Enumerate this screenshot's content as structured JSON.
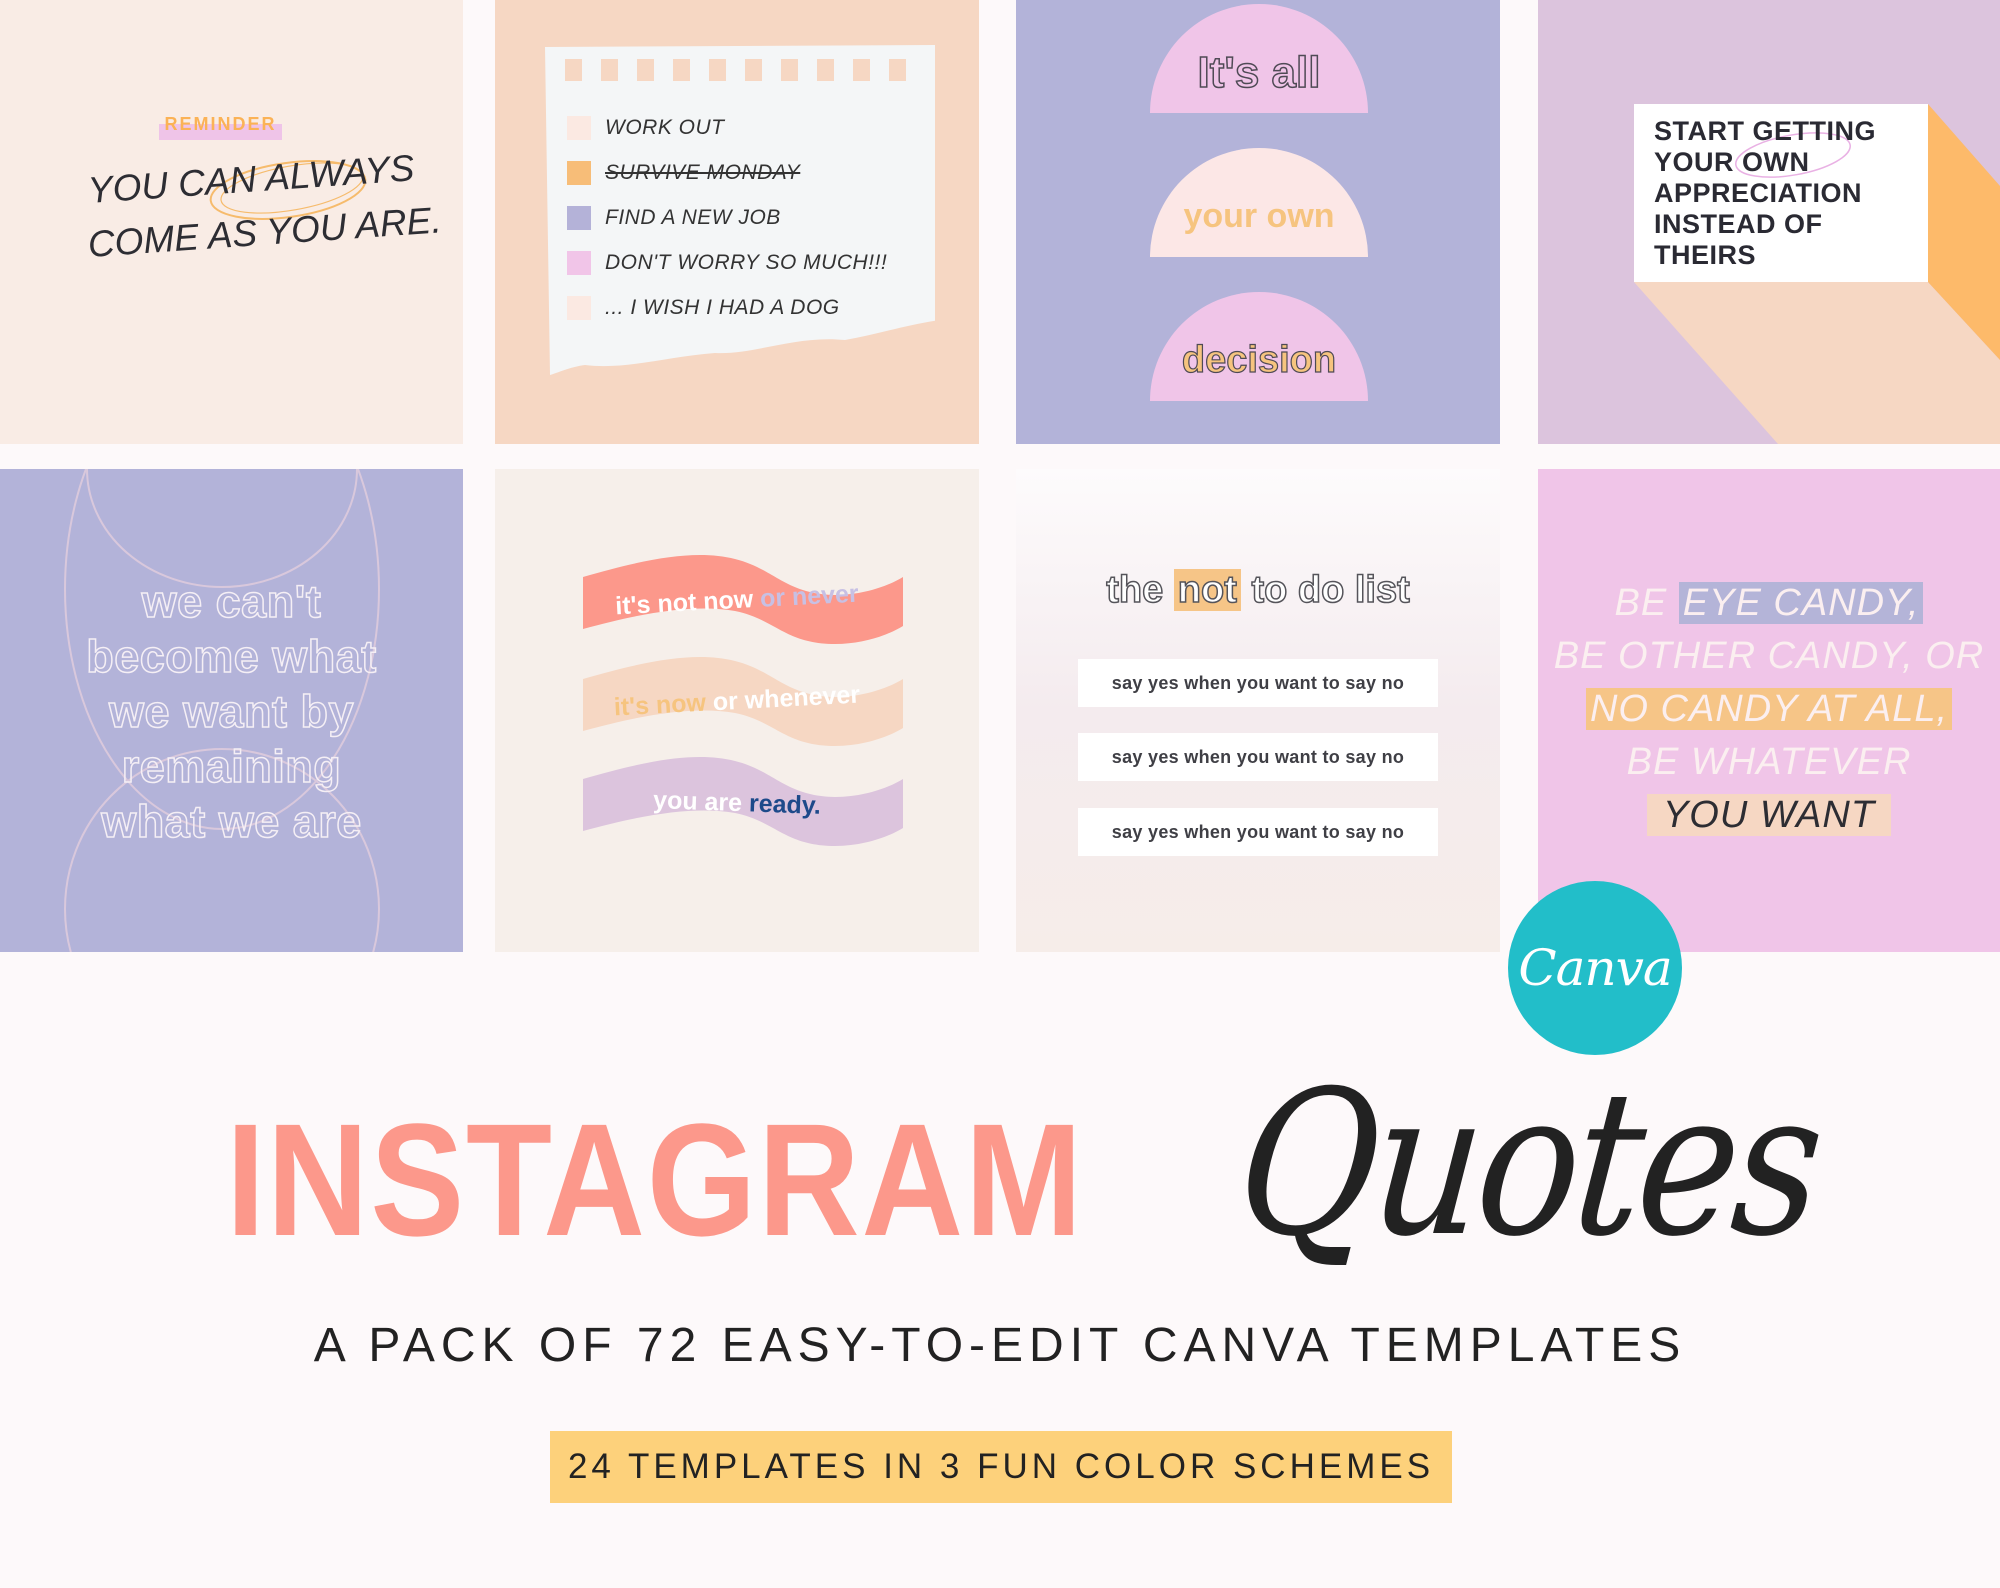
{
  "colors": {
    "background": "#fdf9fa",
    "coral": "#fc988b",
    "peach": "#f6d7c3",
    "lavender": "#b3b3d9",
    "pink": "#f0c5e8",
    "orange": "#f6c587",
    "canva_teal": "#22bec9",
    "banner_yellow": "#fdd17b",
    "navy": "#1d4a8a",
    "ink": "#2d2d33"
  },
  "templates": [
    {
      "id": "reminder",
      "label": "REMINDER",
      "lines": [
        "YOU CAN ALWAYS",
        "COME AS YOU ARE."
      ],
      "line1_pre": "YOU CAN ",
      "line1_circled": "ALWAYS",
      "line2": "COME AS YOU ARE."
    },
    {
      "id": "todo-paper",
      "items": [
        {
          "text": "WORK OUT",
          "box_color": "#fbe9e2",
          "struck": false
        },
        {
          "text": "SURVIVE MONDAY",
          "box_color": "#f7bd78",
          "struck": true
        },
        {
          "text": "FIND A NEW JOB",
          "box_color": "#b4b2d8",
          "struck": false
        },
        {
          "text": "DON'T WORRY SO MUCH!!!",
          "box_color": "#f1c5e8",
          "struck": false
        },
        {
          "text": "... I WISH I HAD A DOG",
          "box_color": "#fbe9e2",
          "struck": false
        }
      ]
    },
    {
      "id": "domes",
      "words": [
        "It's all",
        "your own",
        "decision"
      ]
    },
    {
      "id": "appreciation-card",
      "lines": [
        "START GETTING",
        "YOUR OWN",
        "APPRECIATION",
        "INSTEAD OF",
        "THEIRS"
      ]
    },
    {
      "id": "outline-quote",
      "lines": [
        "we can't",
        "become what",
        "we want by",
        "remaining",
        "what we are"
      ]
    },
    {
      "id": "waves",
      "waves": [
        {
          "part1": "it's not now",
          "part2": "or never"
        },
        {
          "part1": "it's now",
          "part2": "or whenever"
        },
        {
          "part1": "you are",
          "part2": "ready."
        }
      ]
    },
    {
      "id": "not-to-do",
      "title_pre": "the",
      "title_highlight": "not",
      "title_post": "to do list",
      "rows": [
        "say yes when you want to say no",
        "say yes when you want to say no",
        "say yes when you want to say no"
      ]
    },
    {
      "id": "eye-candy",
      "line1_pre": "BE ",
      "line1_hl": "EYE CANDY,",
      "line2": "BE OTHER CANDY, OR",
      "line3_hl": "NO CANDY AT ALL,",
      "line4": "BE WHATEVER",
      "line5_hl": "YOU WANT"
    }
  ],
  "badge": {
    "label": "Canva",
    "icon": "canva-logo-icon"
  },
  "hero": {
    "title": "INSTAGRAM",
    "script": "Quotes",
    "subtitle": "A PACK OF 72 EASY-TO-EDIT CANVA TEMPLATES",
    "banner": "24 TEMPLATES IN 3 FUN COLOR SCHEMES"
  }
}
